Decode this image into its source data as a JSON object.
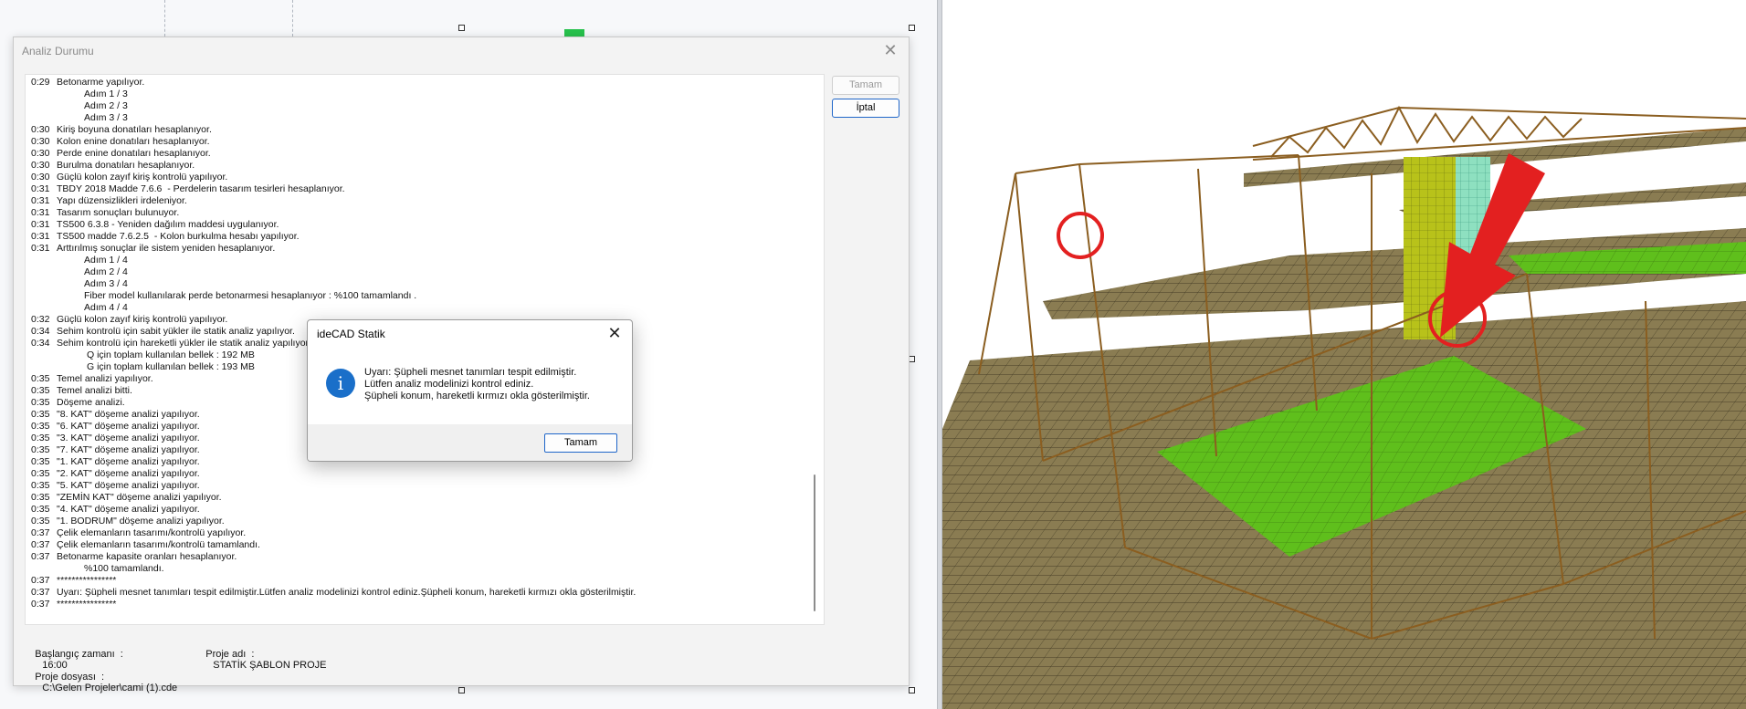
{
  "analysis_window": {
    "title": "Analiz Durumu",
    "close_glyph": "✕",
    "buttons": {
      "ok": "Tamam",
      "cancel": "İptal"
    },
    "log": [
      {
        "t": "0:29",
        "text": "Betonarme yapılıyor.",
        "indent": 0
      },
      {
        "t": "",
        "text": "Adım 1 / 3",
        "indent": 1
      },
      {
        "t": "",
        "text": "Adım 2 / 3",
        "indent": 1
      },
      {
        "t": "",
        "text": "Adım 3 / 3",
        "indent": 1
      },
      {
        "t": "0:30",
        "text": "Kiriş boyuna donatıları hesaplanıyor.",
        "indent": 0
      },
      {
        "t": "0:30",
        "text": "Kolon enine donatıları hesaplanıyor.",
        "indent": 0
      },
      {
        "t": "0:30",
        "text": "Perde enine donatıları hesaplanıyor.",
        "indent": 0
      },
      {
        "t": "0:30",
        "text": "Burulma donatıları hesaplanıyor.",
        "indent": 0
      },
      {
        "t": "0:30",
        "text": "Güçlü kolon zayıf kiriş kontrolü yapılıyor.",
        "indent": 0
      },
      {
        "t": "0:31",
        "text": "TBDY 2018 Madde 7.6.6  - Perdelerin tasarım tesirleri hesaplanıyor.",
        "indent": 0
      },
      {
        "t": "0:31",
        "text": "Yapı düzensizlikleri irdeleniyor.",
        "indent": 0
      },
      {
        "t": "0:31",
        "text": "Tasarım sonuçları bulunuyor.",
        "indent": 0
      },
      {
        "t": "0:31",
        "text": "TS500 6.3.8 - Yeniden dağılım maddesi uygulanıyor.",
        "indent": 0
      },
      {
        "t": "0:31",
        "text": "TS500 madde 7.6.2.5  - Kolon burkulma hesabı yapılıyor.",
        "indent": 0
      },
      {
        "t": "0:31",
        "text": "Arttırılmış sonuçlar ile sistem yeniden hesaplanıyor.",
        "indent": 0
      },
      {
        "t": "",
        "text": "Adım 1 / 4",
        "indent": 1
      },
      {
        "t": "",
        "text": "Adım 2 / 4",
        "indent": 1
      },
      {
        "t": "",
        "text": "Adım 3 / 4",
        "indent": 1
      },
      {
        "t": "",
        "text": "Fiber model kullanılarak perde betonarmesi hesaplanıyor : %100 tamamlandı .",
        "indent": 1
      },
      {
        "t": "",
        "text": "Adım 4 / 4",
        "indent": 1
      },
      {
        "t": "0:32",
        "text": "Güçlü kolon zayıf kiriş kontrolü yapılıyor.",
        "indent": 0
      },
      {
        "t": "0:34",
        "text": "Sehim kontrolü için sabit yükler ile statik analiz yapılıyor.",
        "indent": 0
      },
      {
        "t": "0:34",
        "text": "Sehim kontrolü için hareketli yükler ile statik analiz yapılıyor.",
        "indent": 0
      },
      {
        "t": "",
        "text": "Q için toplam kullanılan bellek : 192 MB",
        "indent": 2
      },
      {
        "t": "",
        "text": "G için toplam kullanılan bellek : 193 MB",
        "indent": 2
      },
      {
        "t": "0:35",
        "text": "Temel analizi yapılıyor.",
        "indent": 0
      },
      {
        "t": "0:35",
        "text": "Temel analizi bitti.",
        "indent": 0
      },
      {
        "t": "0:35",
        "text": "Döşeme analizi.",
        "indent": 0
      },
      {
        "t": "0:35",
        "text": "\"8. KAT\" döşeme analizi yapılıyor.",
        "indent": 0
      },
      {
        "t": "0:35",
        "text": "\"6. KAT\" döşeme analizi yapılıyor.",
        "indent": 0
      },
      {
        "t": "0:35",
        "text": "\"3. KAT\" döşeme analizi yapılıyor.",
        "indent": 0
      },
      {
        "t": "0:35",
        "text": "\"7. KAT\" döşeme analizi yapılıyor.",
        "indent": 0
      },
      {
        "t": "0:35",
        "text": "\"1. KAT\" döşeme analizi yapılıyor.",
        "indent": 0
      },
      {
        "t": "0:35",
        "text": "\"2. KAT\" döşeme analizi yapılıyor.",
        "indent": 0
      },
      {
        "t": "0:35",
        "text": "\"5. KAT\" döşeme analizi yapılıyor.",
        "indent": 0
      },
      {
        "t": "0:35",
        "text": "\"ZEMİN KAT\" döşeme analizi yapılıyor.",
        "indent": 0
      },
      {
        "t": "0:35",
        "text": "\"4. KAT\" döşeme analizi yapılıyor.",
        "indent": 0
      },
      {
        "t": "0:35",
        "text": "\"1. BODRUM\" döşeme analizi yapılıyor.",
        "indent": 0
      },
      {
        "t": "0:37",
        "text": "Çelik elemanların tasarımı/kontrolü yapılıyor.",
        "indent": 0
      },
      {
        "t": "0:37",
        "text": "Çelik elemanların tasarımı/kontrolü tamamlandı.",
        "indent": 0
      },
      {
        "t": "0:37",
        "text": "Betonarme kapasite oranları hesaplanıyor.",
        "indent": 0
      },
      {
        "t": "",
        "text": "%100 tamamlandı.",
        "indent": 1
      },
      {
        "t": "0:37",
        "text": "****************",
        "indent": 0
      },
      {
        "t": "0:37",
        "text": "Uyarı: Şüpheli mesnet tanımları tespit edilmiştir.Lütfen analiz modelinizi kontrol ediniz.Şüpheli konum, hareketli kırmızı okla gösterilmiştir.",
        "indent": 0
      },
      {
        "t": "0:37",
        "text": "****************",
        "indent": 0
      }
    ],
    "info": {
      "start_label": "Başlangıç zamanı  :",
      "start_value": "16:00",
      "project_label": "Proje adı  :",
      "project_value": "STATİK ŞABLON PROJE",
      "file_label": "Proje dosyası  :",
      "file_value": "C:\\Gelen Projeler\\cami (1).cde"
    }
  },
  "message_box": {
    "title": "ideCAD Statik",
    "close_glyph": "✕",
    "icon": "info-icon",
    "icon_glyph": "i",
    "lines": [
      "Uyarı: Şüpheli mesnet tanımları tespit edilmiştir.",
      "Lütfen analiz modelinizi kontrol ediniz.",
      "Şüpheli konum, hareketli kırmızı okla gösterilmiştir."
    ],
    "ok_label": "Tamam"
  },
  "colors": {
    "accent": "#1f66c9",
    "frame": "#8b5e20",
    "slab": "#8a7c52",
    "highlight_slab": "#5fbf1c",
    "wall": "#b8c21a",
    "warning_red": "#e32020"
  }
}
